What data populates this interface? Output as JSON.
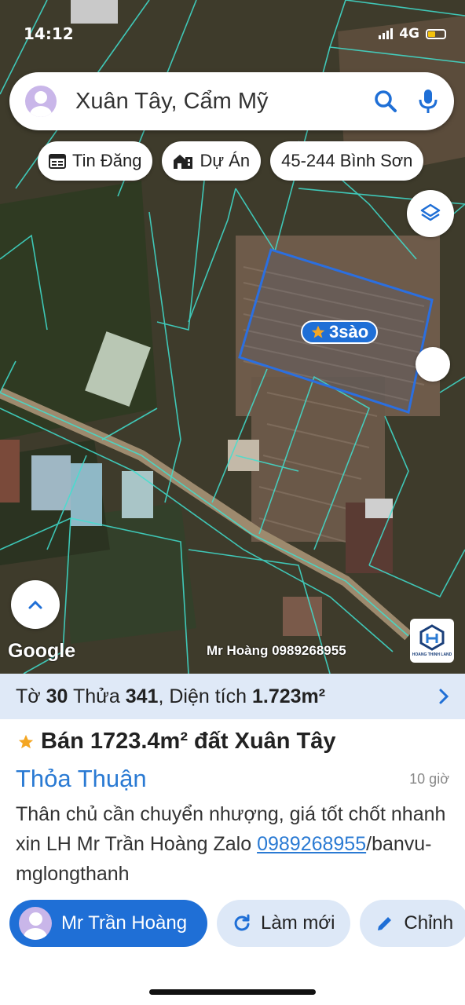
{
  "status_bar": {
    "time": "14:12",
    "network": "4G"
  },
  "search": {
    "query": "Xuân Tây, Cẩm Mỹ",
    "icons": [
      "search-icon",
      "mic-icon"
    ]
  },
  "chips": [
    {
      "label": "Tin Đăng",
      "icon": "calendar-icon"
    },
    {
      "label": "Dự Án",
      "icon": "building-icon"
    },
    {
      "label": "45-244 Bình Sơn"
    }
  ],
  "map": {
    "parcel_label": "3sào",
    "google_label": "Google",
    "watermark": "Mr Hoàng 0989268955",
    "brand_caption": "HOANG THINH LAND",
    "colors": {
      "parcel_border": "#2b6fe0",
      "lot_lines": "#40e0d0"
    }
  },
  "lot_info": {
    "to_label": "Tờ",
    "to_value": "30",
    "thua_label": "Thửa",
    "thua_value": "341",
    "area_label": "Diện tích",
    "area_value": "1.723m²"
  },
  "listing": {
    "title": "Bán 1723.4m² đất Xuân Tây",
    "price": "Thỏa Thuận",
    "time_ago": "10 giờ",
    "desc_part1": "Thân chủ cần chuyển nhượng, giá tốt chốt nhanh xin LH Mr Trần Hoàng Zalo ",
    "phone": "0989268955",
    "desc_part2": "/banvu-mglongthanh"
  },
  "actions": {
    "contact_name": "Mr Trần Hoàng",
    "refresh_label": "Làm mới",
    "edit_label": "Chỉnh"
  },
  "colors": {
    "accent": "#1f6fd6",
    "link": "#2a7ad3",
    "lot_bar_bg": "#dfe9f7",
    "star": "#f4a623"
  }
}
